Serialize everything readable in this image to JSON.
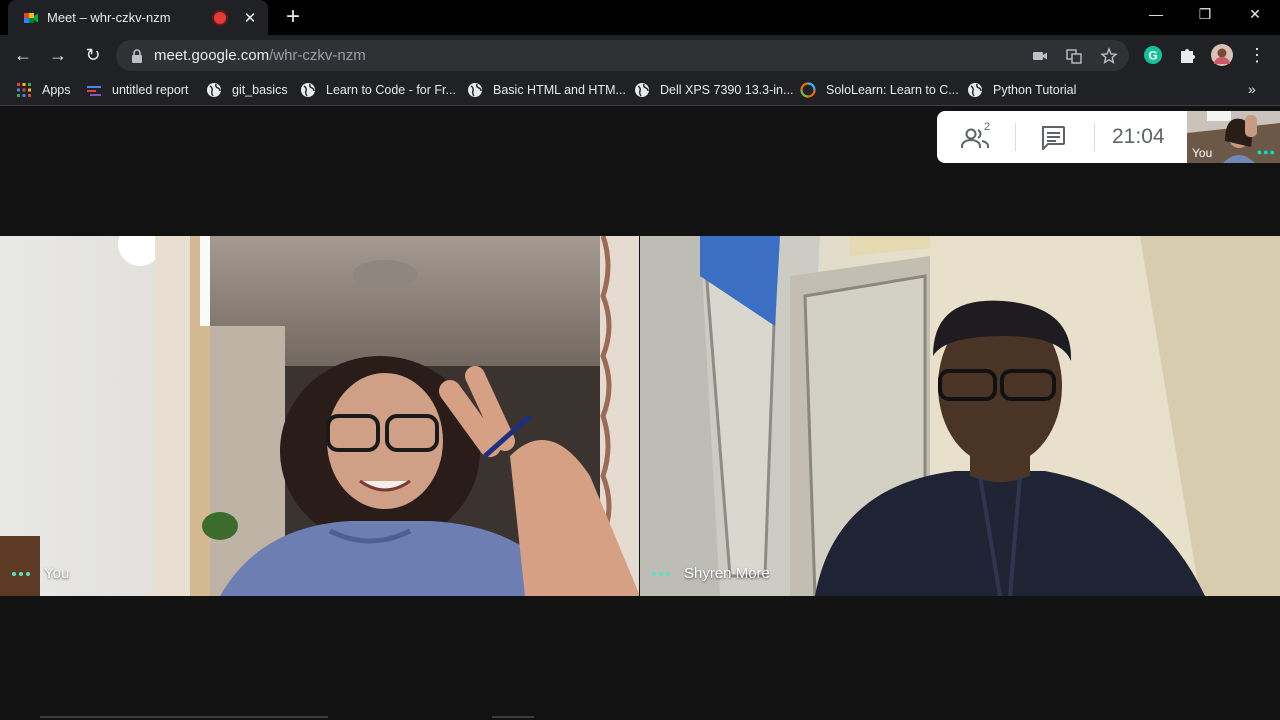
{
  "tab": {
    "title": "Meet – whr-czkv-nzm"
  },
  "omnibox": {
    "host": "meet.google.com",
    "path": "/whr-czkv-nzm"
  },
  "bookmarks": [
    {
      "label": "Apps",
      "icon": "apps-grid-icon"
    },
    {
      "label": "untitled report",
      "icon": "report-icon"
    },
    {
      "label": "git_basics",
      "icon": "globe-icon"
    },
    {
      "label": "Learn to Code - for Fr...",
      "icon": "globe-icon"
    },
    {
      "label": "Basic HTML and HTM...",
      "icon": "globe-icon"
    },
    {
      "label": "Dell XPS 7390 13.3-in...",
      "icon": "globe-icon"
    },
    {
      "label": "SoloLearn: Learn to C...",
      "icon": "sololearn-icon"
    },
    {
      "label": "Python Tutorial",
      "icon": "globe-icon"
    }
  ],
  "meeting": {
    "participants_count": "2",
    "clock": "21:04",
    "self_view_label": "You",
    "tiles": [
      {
        "name": "You"
      },
      {
        "name": "Shyren More"
      }
    ]
  },
  "colors": {
    "accent_teal": "#5ce1c2",
    "recording_red": "#e53935",
    "grammarly_green": "#15c39a"
  }
}
